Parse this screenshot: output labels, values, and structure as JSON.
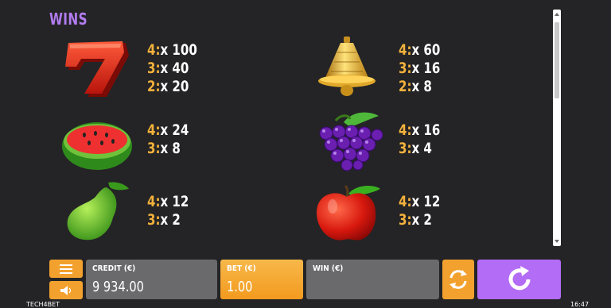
{
  "page": {
    "title": "WINS"
  },
  "symbols": [
    {
      "name": "seven",
      "payouts": [
        {
          "k": "4:",
          "v": "x 100"
        },
        {
          "k": "3:",
          "v": "x 40"
        },
        {
          "k": "2:",
          "v": "x 20"
        }
      ]
    },
    {
      "name": "bell",
      "payouts": [
        {
          "k": "4:",
          "v": "x 60"
        },
        {
          "k": "3:",
          "v": "x 16"
        },
        {
          "k": "2:",
          "v": "x 8"
        }
      ]
    },
    {
      "name": "watermelon",
      "payouts": [
        {
          "k": "4:",
          "v": "x 24"
        },
        {
          "k": "3:",
          "v": "x 8"
        }
      ]
    },
    {
      "name": "grapes",
      "payouts": [
        {
          "k": "4:",
          "v": "x 16"
        },
        {
          "k": "3:",
          "v": "x 4"
        }
      ]
    },
    {
      "name": "pear",
      "payouts": [
        {
          "k": "4:",
          "v": "x 12"
        },
        {
          "k": "3:",
          "v": "x 2"
        }
      ]
    },
    {
      "name": "apple",
      "payouts": [
        {
          "k": "4:",
          "v": "x 12"
        },
        {
          "k": "3:",
          "v": "x 2"
        }
      ]
    }
  ],
  "bottom_bar": {
    "credit": {
      "label": "CREDIT (€)",
      "value": "9 934.00"
    },
    "bet": {
      "label": "BET (€)",
      "value": "1.00"
    },
    "win": {
      "label": "WIN (€)",
      "value": ""
    },
    "icons": {
      "menu": "menu-icon",
      "sound": "sound-icon",
      "autoplay": "autoplay-icon",
      "spin": "spin-icon"
    }
  },
  "footer": {
    "brand": "TECH4BET",
    "time": "16:47"
  },
  "colors": {
    "accent_orange": "#f3a12e",
    "spin_purple": "#b36cf5",
    "title_purple": "#b27cf0",
    "payout_key": "#f4b23c",
    "background": "#242426"
  }
}
